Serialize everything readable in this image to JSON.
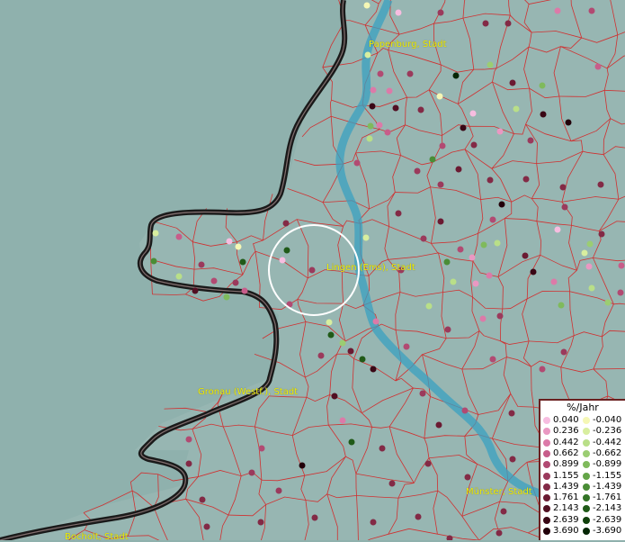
{
  "map": {
    "cities": [
      {
        "name": "Papenburg, Stadt"
      },
      {
        "name": "Lingen (Ems), Stadt"
      },
      {
        "name": "Gronau (Westf.), Stadt"
      },
      {
        "name": "Münster, Stadt"
      },
      {
        "name": "Bocholt, Stadt"
      }
    ]
  },
  "legend": {
    "title": "%/Jahr",
    "positive": [
      {
        "label": "0.040",
        "color": "#f7bde0"
      },
      {
        "label": "0.236",
        "color": "#ea98c2"
      },
      {
        "label": "0.442",
        "color": "#dc7aa8"
      },
      {
        "label": "0.662",
        "color": "#c85d8a"
      },
      {
        "label": "0.899",
        "color": "#b24a72"
      },
      {
        "label": "1.155",
        "color": "#9b3a5c"
      },
      {
        "label": "1.439",
        "color": "#832a46"
      },
      {
        "label": "1.761",
        "color": "#6b1a32"
      },
      {
        "label": "2.143",
        "color": "#520f22"
      },
      {
        "label": "2.639",
        "color": "#3a0715"
      },
      {
        "label": "3.690",
        "color": "#22000a"
      }
    ],
    "negative": [
      {
        "label": "-0.040",
        "color": "#f5f7b5"
      },
      {
        "label": "-0.236",
        "color": "#d8ee9f"
      },
      {
        "label": "-0.442",
        "color": "#b9df88"
      },
      {
        "label": "-0.662",
        "color": "#9bcd72"
      },
      {
        "label": "-0.899",
        "color": "#7fba5c"
      },
      {
        "label": "-1.155",
        "color": "#64a548"
      },
      {
        "label": "-1.439",
        "color": "#4a8d36"
      },
      {
        "label": "-1.761",
        "color": "#337426"
      },
      {
        "label": "-2.143",
        "color": "#205a18"
      },
      {
        "label": "-2.639",
        "color": "#11400c"
      },
      {
        "label": "-3.690",
        "color": "#052605"
      }
    ]
  }
}
